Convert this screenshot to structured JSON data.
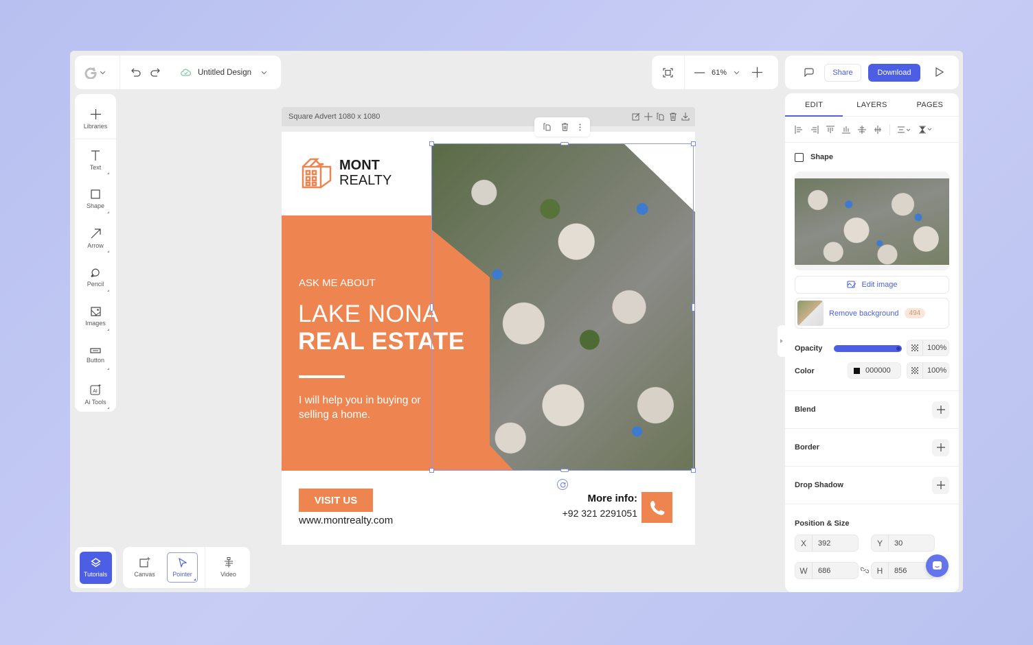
{
  "toolbar": {
    "logo_icon": "g-logo-icon",
    "document_title": "Untitled Design",
    "zoom_level": "61%",
    "share_label": "Share",
    "download_label": "Download"
  },
  "tools": [
    {
      "label": "Libraries",
      "icon": "plus-icon"
    },
    {
      "label": "Text",
      "icon": "text-icon"
    },
    {
      "label": "Shape",
      "icon": "square-icon"
    },
    {
      "label": "Arrow",
      "icon": "arrow-icon"
    },
    {
      "label": "Pencil",
      "icon": "pencil-icon"
    },
    {
      "label": "Images",
      "icon": "image-icon"
    },
    {
      "label": "Button",
      "icon": "button-icon"
    },
    {
      "label": "Ai Tools",
      "icon": "ai-icon"
    }
  ],
  "bottom": {
    "tutorials_label": "Tutorials",
    "modes": [
      {
        "label": "Canvas",
        "active": false
      },
      {
        "label": "Pointer",
        "active": true
      },
      {
        "label": "Video",
        "active": false
      }
    ]
  },
  "canvas": {
    "page_title": "Square Advert 1080 x 1080"
  },
  "design": {
    "brand_line1": "MONT",
    "brand_line2": "REALTY",
    "ask": "ASK ME ABOUT",
    "headline1": "LAKE NONA",
    "headline2": "REAL ESTATE",
    "body": "I will help you in buying or selling a home.",
    "cta": "VISIT US",
    "website": "www.montrealty.com",
    "more_info": "More info:",
    "phone": "+92 321 2291051",
    "accent": "#ee844f"
  },
  "panel": {
    "tabs": [
      {
        "label": "EDIT",
        "active": true
      },
      {
        "label": "LAYERS",
        "active": false
      },
      {
        "label": "PAGES",
        "active": false
      }
    ],
    "element_type": "Shape",
    "edit_image_label": "Edit image",
    "remove_bg_label": "Remove background",
    "remove_bg_credits": "494",
    "opacity_label": "Opacity",
    "opacity_value": 1.0,
    "opacity_text": "100%",
    "color_label": "Color",
    "color_hex": "000000",
    "color_alpha": "100%",
    "sections": [
      "Blend",
      "Border",
      "Drop Shadow"
    ],
    "position_title": "Position & Size",
    "x_label": "X",
    "x": "392",
    "y_label": "Y",
    "y": "30",
    "w_label": "W",
    "w": "686",
    "h_label": "H",
    "h": "856"
  },
  "colors": {
    "primary": "#4b5ee4",
    "accent": "#ee844f"
  }
}
